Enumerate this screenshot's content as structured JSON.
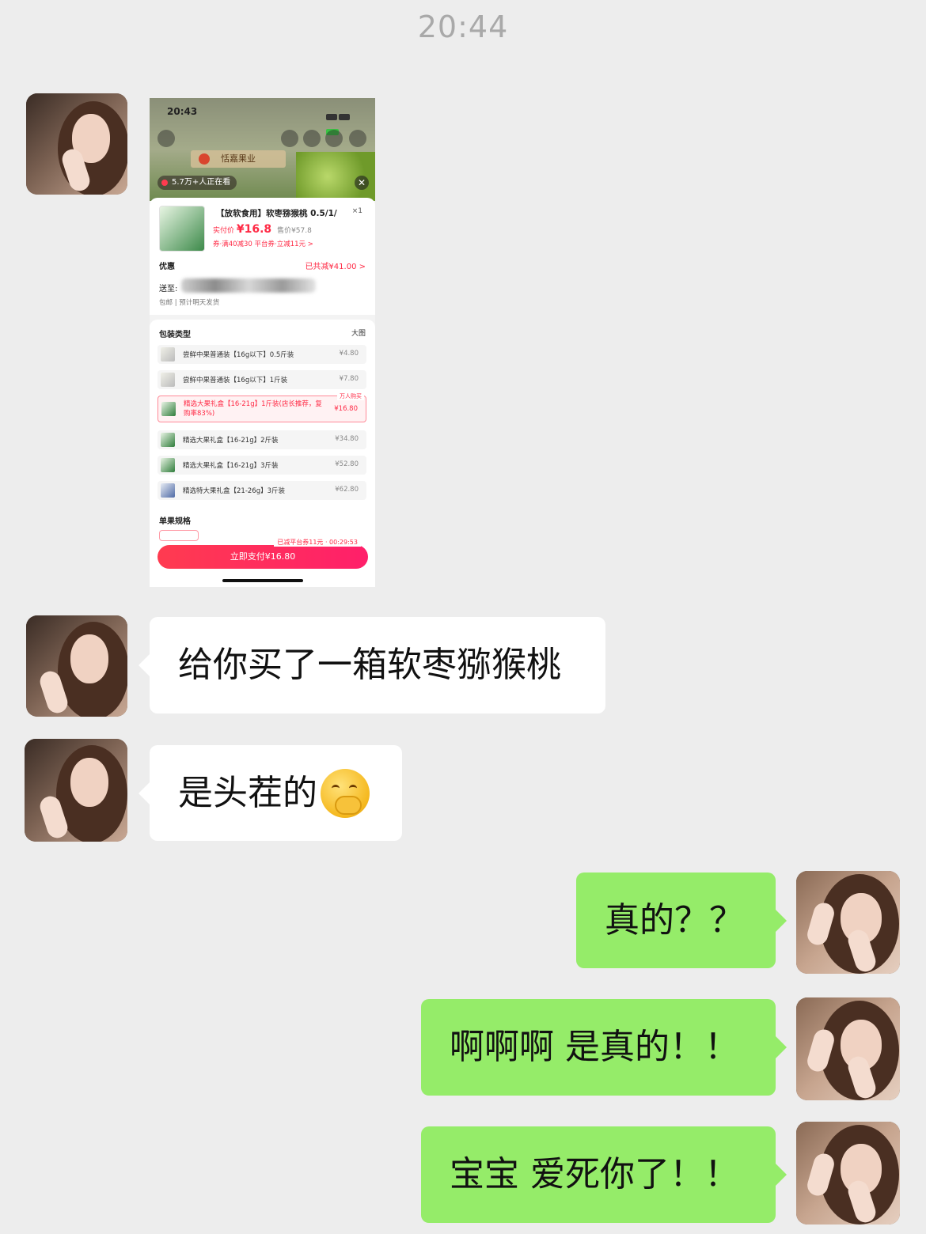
{
  "time": "20:44",
  "screenshot": {
    "status_time": "20:43",
    "brand": "恬嘉果业",
    "watching": "5.7万+人正在看",
    "close": "✕",
    "product_title": "【放软食用】软枣猕猴桃 0.5/1/",
    "quantity": "×1",
    "pay_price_label": "实付价",
    "pay_price": "¥16.8",
    "orig_price": "售价¥57.8",
    "coupon_text": "券·满40减30    平台券·立减11元 >",
    "discount_label": "优惠",
    "discount_value": "已共减¥41.00 >",
    "ship_label": "送至:",
    "ship_note": "包邮 | 预计明天发货",
    "package_title": "包装类型",
    "big_view": "大图",
    "options": [
      {
        "label": "尝鲜中果普通装【16g以下】0.5斤装",
        "price": "¥4.80"
      },
      {
        "label": "尝鲜中果普通装【16g以下】1斤装",
        "price": "¥7.80"
      },
      {
        "label": "精选大果礼盒【16-21g】1斤装(店长推荐，复购率83%)",
        "price": "¥16.80",
        "tag": "万人购买"
      },
      {
        "label": "精选大果礼盒【16-21g】2斤装",
        "price": "¥34.80"
      },
      {
        "label": "精选大果礼盒【16-21g】3斤装",
        "price": "¥52.80"
      },
      {
        "label": "精选特大果礼盒【21-26g】3斤装",
        "price": "¥62.80"
      }
    ],
    "spec_title": "单果规格",
    "timer": "已减平台券11元 · 00:29:53",
    "pay_button": "立即支付¥16.80"
  },
  "messages": [
    {
      "side": "in",
      "text": "给你买了一箱软枣猕猴桃"
    },
    {
      "side": "in",
      "text": "是头茬的",
      "emoji": "face-with-hand-over-mouth"
    },
    {
      "side": "out",
      "text": "真的？？"
    },
    {
      "side": "out",
      "text": "啊啊啊 是真的！！"
    },
    {
      "side": "out",
      "text": "宝宝 爱死你了！！"
    }
  ],
  "colors": {
    "background": "#ededed",
    "bubble_in": "#ffffff",
    "bubble_out": "#95ec69",
    "accent_red": "#ff2a45"
  }
}
